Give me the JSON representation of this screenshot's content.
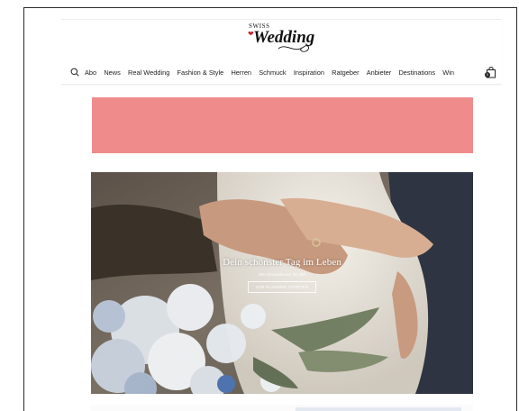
{
  "brand": {
    "top": "SWISS",
    "name": "Wedding"
  },
  "nav": {
    "items": [
      "Abo",
      "News",
      "Real Wedding",
      "Fashion & Style",
      "Herren",
      "Schmuck",
      "Inspiration",
      "Ratgeber",
      "Anbieter",
      "Destinations",
      "Win"
    ],
    "cart_count": "0"
  },
  "banner": {
    "color": "#f08b8b"
  },
  "hero": {
    "title": "Dein schönster Tag im Leben",
    "subtitle": "Alle Informationen für dich",
    "button": "ZUR PLANUNG STARTEN"
  },
  "colors": {
    "brand_red": "#c8262f",
    "text": "#222222"
  }
}
